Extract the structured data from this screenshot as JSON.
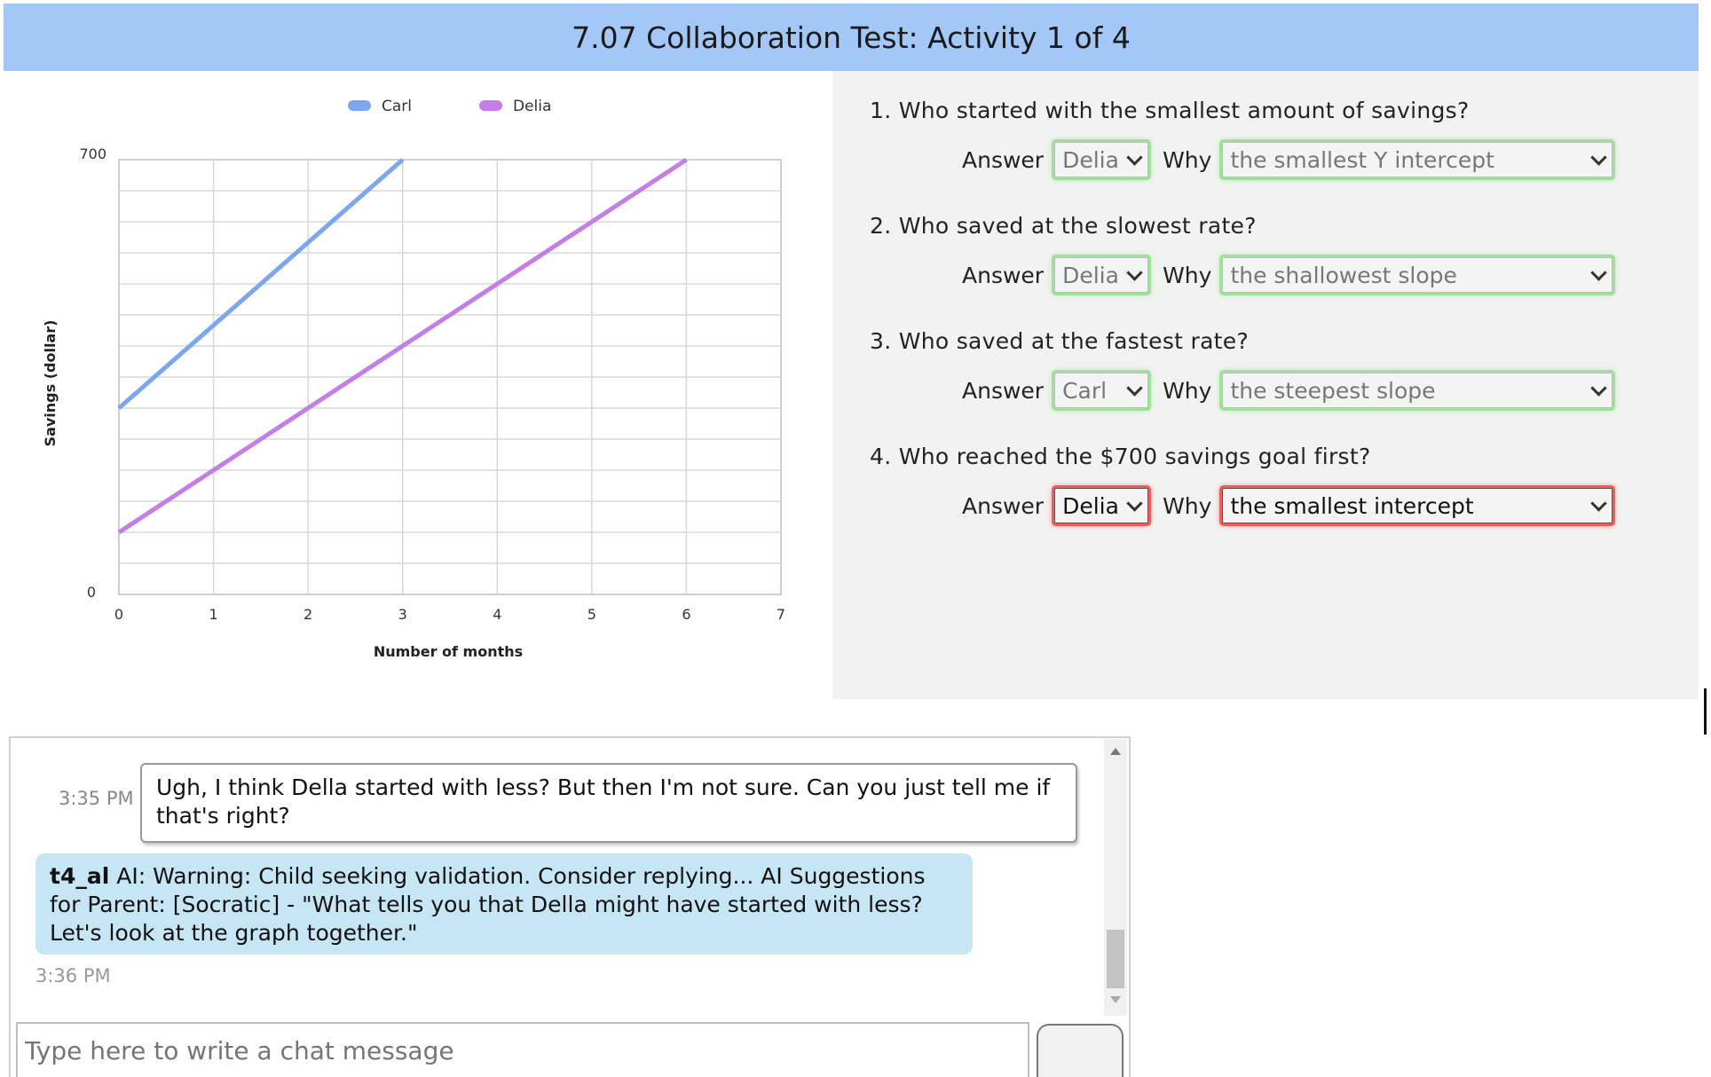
{
  "header": {
    "title": "7.07 Collaboration Test: Activity 1 of 4"
  },
  "chart_data": {
    "type": "line",
    "x": [
      0,
      1,
      2,
      3,
      4,
      5,
      6,
      7
    ],
    "series": [
      {
        "name": "Carl",
        "color": "#7aa7ef",
        "x": [
          0,
          3
        ],
        "values": [
          300,
          700
        ]
      },
      {
        "name": "Delia",
        "color": "#c47ee7",
        "x": [
          0,
          6
        ],
        "values": [
          100,
          700
        ]
      }
    ],
    "xlabel": "Number of months",
    "ylabel": "Savings (dollar)",
    "xlim": [
      0,
      7
    ],
    "ylim": [
      0,
      700
    ],
    "y_tick_labels": [
      "0",
      "700"
    ],
    "x_tick_labels": [
      "0",
      "1",
      "2",
      "3",
      "4",
      "5",
      "6",
      "7"
    ],
    "grid": true,
    "legend_position": "top"
  },
  "questions": [
    {
      "text": "1. Who started with the smallest amount of savings?",
      "answer_label": "Answer",
      "answer": "Delia",
      "why_label": "Why",
      "why": "the smallest Y intercept",
      "status": "correct"
    },
    {
      "text": "2. Who saved at the slowest rate?",
      "answer_label": "Answer",
      "answer": "Delia",
      "why_label": "Why",
      "why": "the shallowest slope",
      "status": "correct"
    },
    {
      "text": "3. Who saved at the fastest rate?",
      "answer_label": "Answer",
      "answer": "Carl",
      "why_label": "Why",
      "why": "the steepest slope",
      "status": "correct"
    },
    {
      "text": "4. Who reached the $700 savings goal first?",
      "answer_label": "Answer",
      "answer": "Delia",
      "why_label": "Why",
      "why": "the smallest intercept",
      "status": "incorrect"
    }
  ],
  "chat": {
    "messages": [
      {
        "time": "3:35 PM",
        "text": "Ugh, I think Della started with less? But then I'm not sure. Can you just tell me if that's right?"
      },
      {
        "sender": "t4_al",
        "text": " AI: Warning: Child seeking validation. Consider replying... AI Suggestions for Parent: [Socratic] - \"What tells you that Della might have started with less? Let's look at the graph together.\"",
        "time": "3:36 PM"
      }
    ],
    "input_placeholder": "Type here to write a chat message"
  },
  "colors": {
    "header_bg": "#a3c7f7",
    "ai_bubble_bg": "#c6e6f5",
    "correct_glow": "#9fe09a",
    "incorrect_glow": "#f05b5b"
  }
}
